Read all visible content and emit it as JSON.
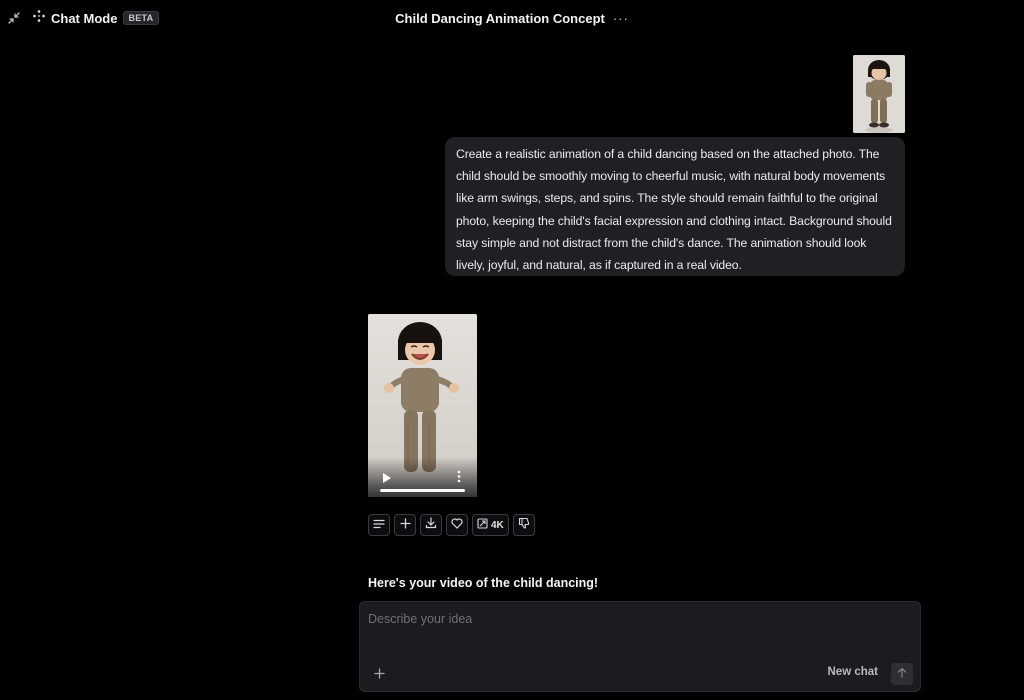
{
  "header": {
    "collapse_icon": "collapse-arrows-icon",
    "brand_icon": "sparkle-dots-icon",
    "brand_name": "Chat Mode",
    "beta_badge": "BETA",
    "chat_title": "Child Dancing Animation Concept",
    "more_label": "···"
  },
  "user_message": {
    "attachment_icon": "child-photo-thumbnail",
    "text": "Create a realistic animation of a child dancing based on the attached photo. The child should be smoothly moving to cheerful music, with natural body movements like arm swings, steps, and spins. The style should remain faithful to the original photo, keeping the child's facial expression and clothing intact. Background should stay simple and not distract from the child's dance. The animation should look lively, joyful, and natural, as if captured in a real video."
  },
  "assistant": {
    "video": {
      "play_icon": "play-icon",
      "menu_icon": "vertical-dots-icon",
      "progress": 1.0
    },
    "actions": {
      "details_icon": "lines-icon",
      "add_icon": "plus-icon",
      "download_icon": "download-icon",
      "favorite_icon": "heart-icon",
      "upscale_icon": "upscale-icon",
      "upscale_label": "4K",
      "dislike_icon": "thumbs-down-icon"
    },
    "text": "Here's your video of the child dancing!"
  },
  "composer": {
    "placeholder": "Describe your idea",
    "value": "",
    "attach_icon": "plus-icon",
    "new_chat_label": "New chat",
    "send_icon": "arrow-up-icon"
  },
  "colors": {
    "background": "#000000",
    "bubble": "#1e2024",
    "composer": "#1b1c20",
    "border": "#3a3b40"
  }
}
